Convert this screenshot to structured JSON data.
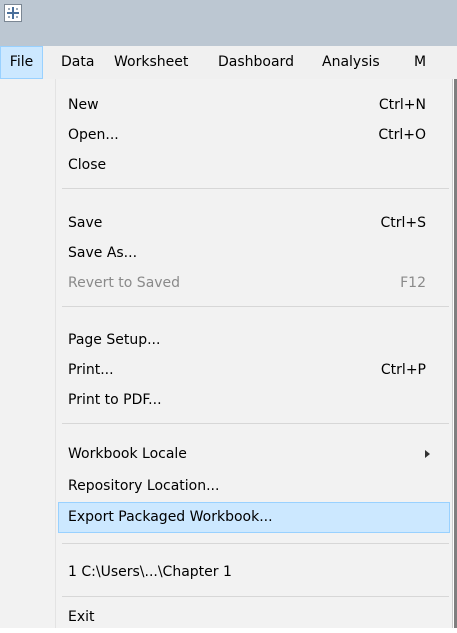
{
  "titlebar": {
    "icon": "app-icon"
  },
  "menubar": {
    "items": [
      {
        "label": "File"
      },
      {
        "label": "Data"
      },
      {
        "label": "Worksheet"
      },
      {
        "label": "Dashboard"
      },
      {
        "label": "Analysis"
      },
      {
        "label": "M"
      }
    ]
  },
  "file_menu": {
    "items": [
      {
        "label": "New",
        "shortcut": "Ctrl+N"
      },
      {
        "label": "Open...",
        "shortcut": "Ctrl+O"
      },
      {
        "label": "Close",
        "shortcut": ""
      },
      {
        "label": "Save",
        "shortcut": "Ctrl+S"
      },
      {
        "label": "Save As...",
        "shortcut": ""
      },
      {
        "label": "Revert to Saved",
        "shortcut": "F12",
        "disabled": true
      },
      {
        "label": "Page Setup...",
        "shortcut": ""
      },
      {
        "label": "Print...",
        "shortcut": "Ctrl+P"
      },
      {
        "label": "Print to PDF...",
        "shortcut": ""
      },
      {
        "label": "Workbook Locale",
        "shortcut": "",
        "submenu_icon": "chevron-right-icon"
      },
      {
        "label": "Repository Location...",
        "shortcut": ""
      },
      {
        "label": "Export Packaged Workbook...",
        "shortcut": "",
        "highlighted": true
      },
      {
        "label": "1 C:\\Users\\...\\Chapter 1",
        "shortcut": ""
      },
      {
        "label": "Exit",
        "shortcut": ""
      }
    ]
  },
  "colors": {
    "titlebar": "#bcc7d2",
    "menu_background": "#f2f2f2",
    "highlight_fill": "#cce8ff",
    "highlight_border": "#99d1ff",
    "disabled_text": "#8a8a8a"
  }
}
